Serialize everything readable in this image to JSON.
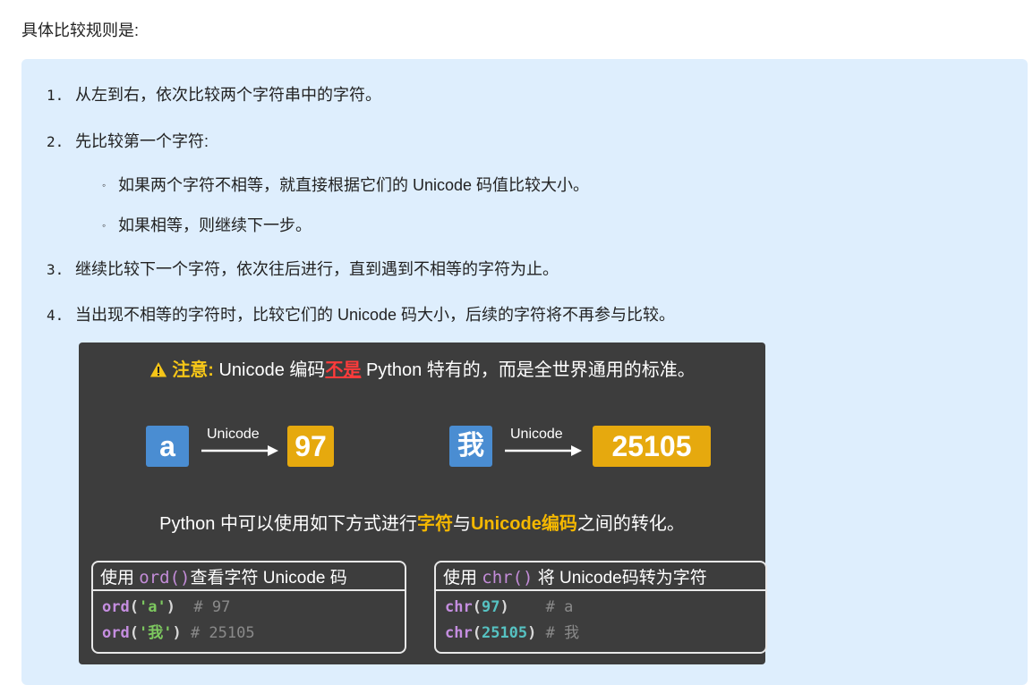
{
  "heading": "具体比较规则是:",
  "rules": [
    {
      "num": "1.",
      "text": "从左到右，依次比较两个字符串中的字符。"
    },
    {
      "num": "2.",
      "text": "先比较第一个字符:"
    },
    {
      "num": "3.",
      "text": "继续比较下一个字符，依次往后进行，直到遇到不相等的字符为止。"
    },
    {
      "num": "4.",
      "text": "当出现不相等的字符时，比较它们的 Unicode 码大小，后续的字符将不再参与比较。"
    }
  ],
  "subrules": [
    {
      "bullet": "◦",
      "text": "如果两个字符不相等，就直接根据它们的 Unicode 码值比较大小。"
    },
    {
      "bullet": "◦",
      "text": "如果相等，则继续下一步。"
    }
  ],
  "card": {
    "note_label": "注意:",
    "note_pre": " Unicode 编码",
    "note_neg": "不是",
    "note_post": " Python 特有的，而是全世界通用的标准。",
    "example1": {
      "char": "a",
      "arrow_label": "Unicode",
      "code": "97"
    },
    "example2": {
      "char": "我",
      "arrow_label": "Unicode",
      "code": "25105"
    },
    "convert_pre": "Python 中可以使用如下方式进行",
    "convert_hl1": "字符",
    "convert_mid": "与",
    "convert_hl2": "Unicode编码",
    "convert_post": "之间的转化。",
    "box_ord": {
      "title_pre": "使用 ",
      "title_fn": "ord()",
      "title_post": "查看字符 Unicode 码",
      "lines": [
        {
          "fn": "ord",
          "open": "(",
          "arg": "'a'",
          "close": ")",
          "pad": "  ",
          "comment": "# 97"
        },
        {
          "fn": "ord",
          "open": "(",
          "arg": "'我'",
          "close": ")",
          "pad": " ",
          "comment": "# 25105"
        }
      ]
    },
    "box_chr": {
      "title_pre": "使用 ",
      "title_fn": "chr()",
      "title_post": " 将 Unicode码转为字符",
      "lines": [
        {
          "fn": "chr",
          "open": "(",
          "arg": "97",
          "close": ")",
          "pad": "    ",
          "comment": "# a"
        },
        {
          "fn": "chr",
          "open": "(",
          "arg": "25105",
          "close": ")",
          "pad": " ",
          "comment": "# 我"
        }
      ]
    }
  }
}
